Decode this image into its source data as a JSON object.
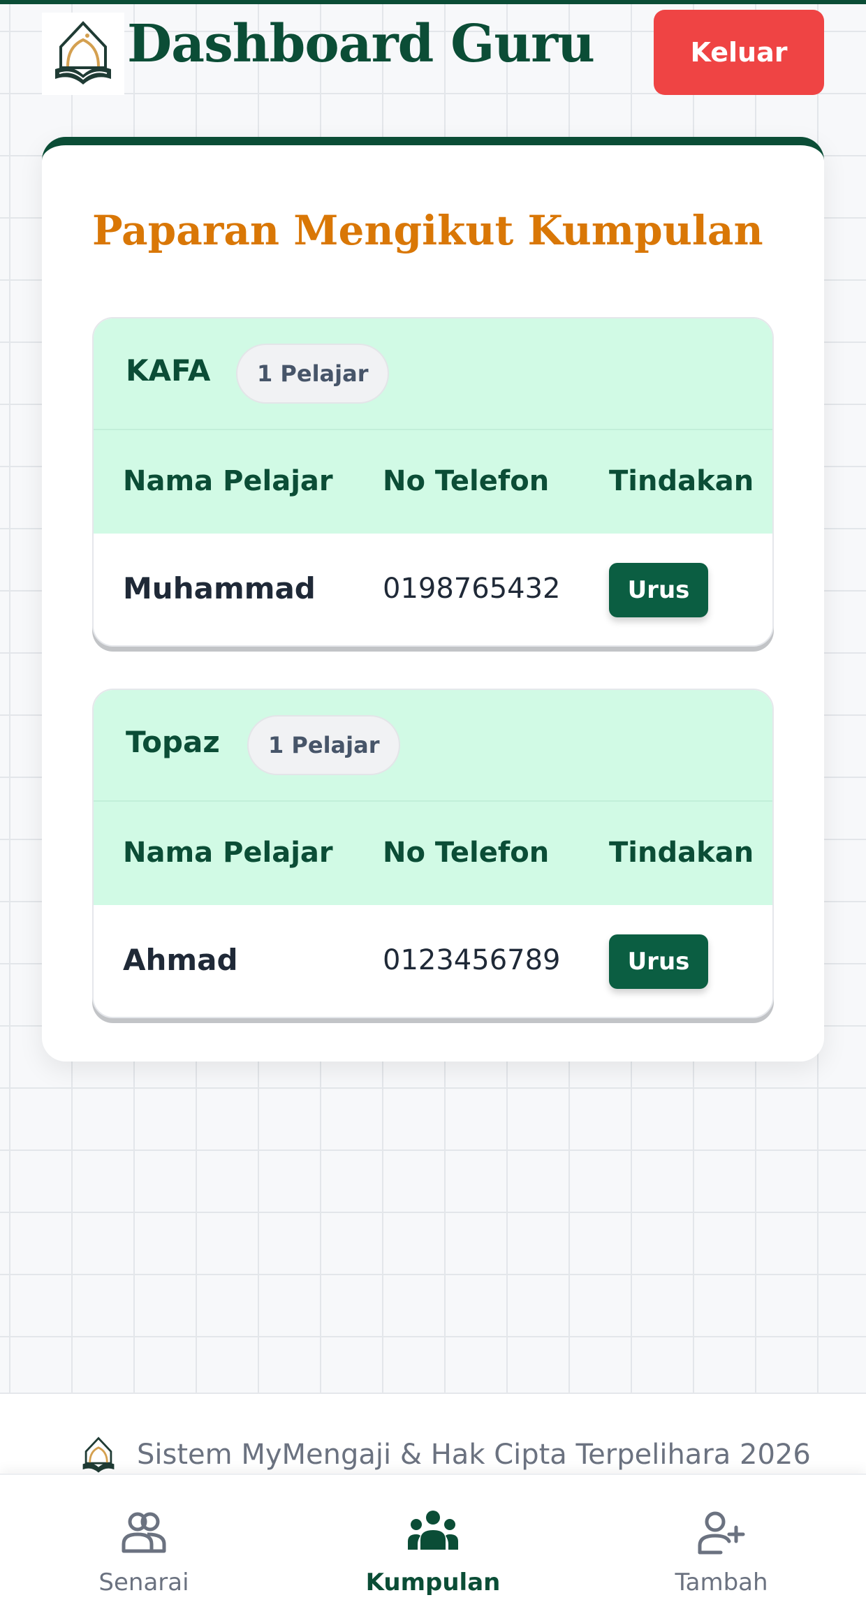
{
  "header": {
    "title": "Dashboard Guru",
    "logout_label": "Keluar"
  },
  "main": {
    "section_title": "Paparan Mengikut Kumpulan",
    "columns": [
      "Nama Pelajar",
      "No Telefon",
      "Tindakan"
    ],
    "groups": [
      {
        "name": "KAFA",
        "count_badge": "1 Pelajar",
        "rows": [
          {
            "name": "Muhammad",
            "phone": "0198765432",
            "action": "Urus"
          }
        ]
      },
      {
        "name": "Topaz",
        "count_badge": "1 Pelajar",
        "rows": [
          {
            "name": "Ahmad",
            "phone": "0123456789",
            "action": "Urus"
          }
        ]
      }
    ]
  },
  "footer": {
    "text": "Sistem MyMengaji & Hak Cipta Terpelihara 2026"
  },
  "nav": {
    "items": [
      {
        "label": "Senarai",
        "icon": "users-icon",
        "active": false
      },
      {
        "label": "Kumpulan",
        "icon": "group-icon",
        "active": true
      },
      {
        "label": "Tambah",
        "icon": "add-user-icon",
        "active": false
      }
    ]
  },
  "colors": {
    "primary": "#0b4d36",
    "accent": "#d97706",
    "danger": "#ef4444",
    "group_header_bg": "#d1fae5"
  }
}
